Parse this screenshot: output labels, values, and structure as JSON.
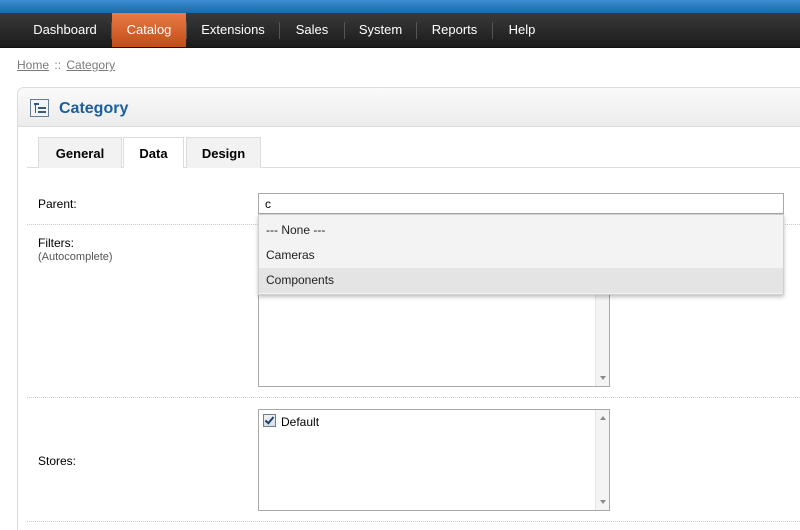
{
  "menu": {
    "items": [
      {
        "label": "Dashboard"
      },
      {
        "label": "Catalog"
      },
      {
        "label": "Extensions"
      },
      {
        "label": "Sales"
      },
      {
        "label": "System"
      },
      {
        "label": "Reports"
      },
      {
        "label": "Help"
      }
    ],
    "active": "Catalog",
    "active_color": "#d2581f"
  },
  "breadcrumb": {
    "home": "Home",
    "separator": "::",
    "current": "Category"
  },
  "box": {
    "title": "Category",
    "icon": "category-tree-icon"
  },
  "tabs": [
    {
      "label": "General"
    },
    {
      "label": "Data"
    },
    {
      "label": "Design"
    }
  ],
  "active_tab": "Data",
  "form": {
    "parent_label": "Parent:",
    "parent_value": "c",
    "filters_label": "Filters:",
    "filters_sub": "(Autocomplete)",
    "stores_label": "Stores:",
    "stores": [
      {
        "label": "Default",
        "checked": true
      }
    ]
  },
  "autocomplete": {
    "items": [
      {
        "label": "--- None ---"
      },
      {
        "label": "Cameras"
      },
      {
        "label": "Components"
      }
    ],
    "highlighted": "Components"
  },
  "colors": {
    "title_blue": "#1b5e9e",
    "menu_bg": "#2a2a2a",
    "top_strip": "#2a7bbf"
  }
}
